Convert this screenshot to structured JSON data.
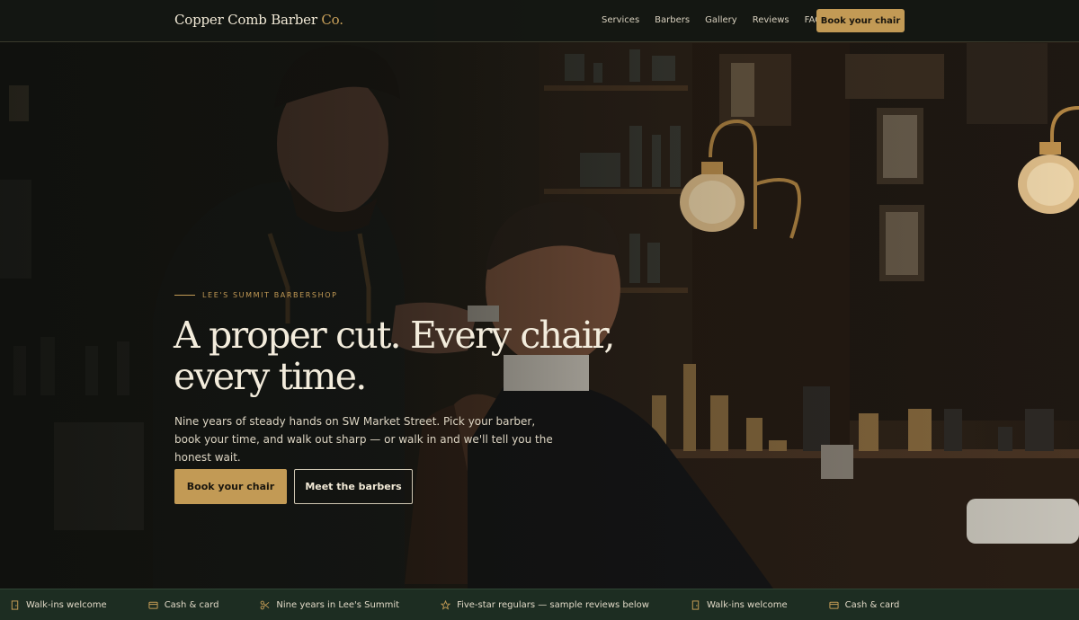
{
  "nav": {
    "brand_main": "Copper Comb Barber",
    "brand_accent": "Co.",
    "links": [
      "Services",
      "Barbers",
      "Gallery",
      "Reviews",
      "FAQ"
    ],
    "cta": "Book your chair"
  },
  "hero": {
    "eyebrow": "Lee's Summit Barbershop",
    "headline_line1": "A proper cut. Every chair,",
    "headline_line2": "every time.",
    "subtext": "Nine years of steady hands on SW Market Street. Pick your barber, book your time, and walk out sharp — or walk in and we'll tell you the honest wait.",
    "primary_button": "Book your chair",
    "secondary_button": "Meet the barbers",
    "image_description": "Barber cutting a client's hair in a dim, wood-paneled barbershop with brass wall lamps and bottles on shelves"
  },
  "ticker": [
    {
      "icon": "door-icon",
      "text": "Walk-ins welcome"
    },
    {
      "icon": "card-icon",
      "text": "Cash & card"
    },
    {
      "icon": "scissors-icon",
      "text": "Nine years in Lee's Summit"
    },
    {
      "icon": "star-icon",
      "text": "Five-star regulars — sample reviews below"
    },
    {
      "icon": "door-icon",
      "text": "Walk-ins welcome"
    },
    {
      "icon": "card-icon",
      "text": "Cash & card"
    }
  ],
  "colors": {
    "accent_gold": "#c29a55",
    "nav_bg": "#141713",
    "ticker_bg": "#1d2d22",
    "text_light": "#f3ecdc"
  }
}
